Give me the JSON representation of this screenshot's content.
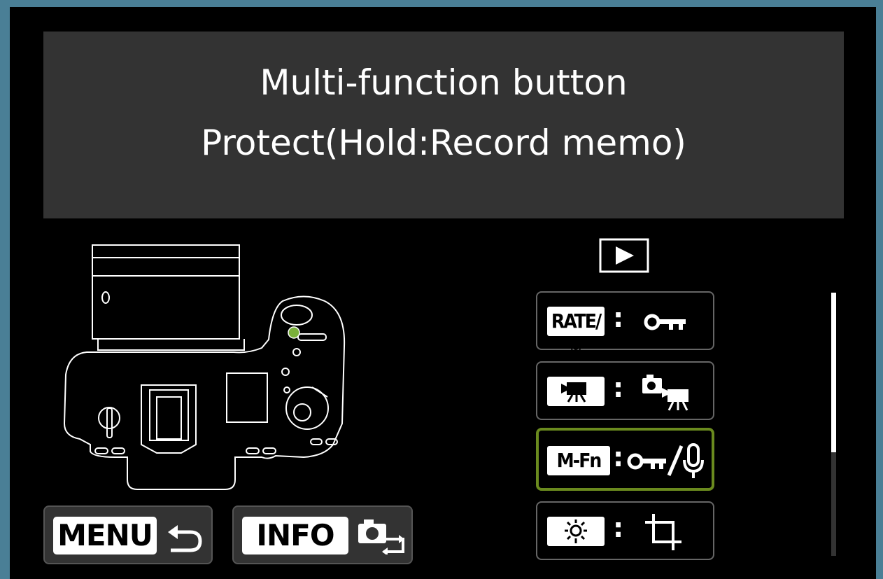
{
  "header": {
    "title": "Multi-function button",
    "subtitle": "Protect(Hold:Record memo)"
  },
  "section_icon": "playback-icon",
  "options": [
    {
      "key_label": "RATE/",
      "key_icon": "microphone-icon",
      "separator": ":",
      "function_icon": "key-protect-icon",
      "selected": false
    },
    {
      "key_label": "",
      "key_icon": "movie-camera-icon",
      "separator": ":",
      "function_icon": "still-movie-switch-icon",
      "selected": false
    },
    {
      "key_label": "M-Fn",
      "key_icon": "",
      "separator": ":",
      "function_icon": "protect-record-memo-icon",
      "selected": true
    },
    {
      "key_label": "",
      "key_icon": "lcd-illumination-icon",
      "separator": ":",
      "function_icon": "crop-icon",
      "selected": false
    }
  ],
  "footer": {
    "menu_label": "MENU",
    "menu_icon": "return-arrow-icon",
    "info_label": "INFO",
    "info_icon": "camera-switch-icon"
  },
  "scrollbar": {
    "position": 0.0,
    "visible_fraction": 0.6
  },
  "colors": {
    "outer_border": "#4a7f96",
    "header_bg": "#333333",
    "selection": "#6a8a1e",
    "highlight_dot": "#7ab03a"
  }
}
